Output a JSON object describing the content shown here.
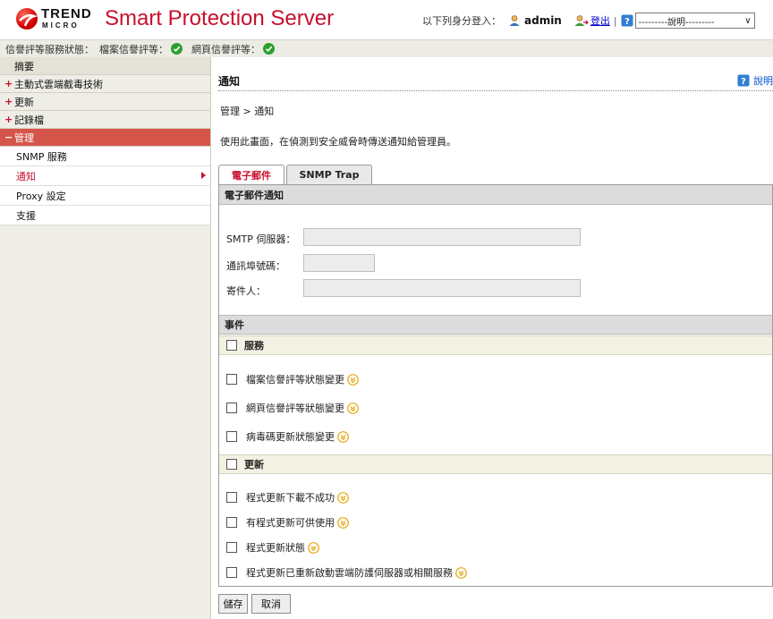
{
  "header": {
    "logo_trend": "TREND",
    "logo_micro": "MICRO",
    "app_title": "Smart Protection Server",
    "login_label": "以下列身分登入：",
    "username": "admin",
    "logout_label": "登出",
    "separator": "|",
    "help_select_value": "---------說明---------"
  },
  "status_bar": {
    "label": "信譽評等服務狀態：",
    "file_rep": "檔案信譽評等：",
    "web_rep": "網頁信譽評等："
  },
  "sidebar": {
    "summary": "摘要",
    "items": [
      {
        "label": "主動式雲端截毒技術",
        "marker": "+"
      },
      {
        "label": "更新",
        "marker": "+"
      },
      {
        "label": "記錄檔",
        "marker": "+"
      },
      {
        "label": "管理",
        "marker": "−"
      }
    ],
    "sub_items": [
      {
        "label": "SNMP 服務"
      },
      {
        "label": "通知"
      },
      {
        "label": "Proxy 設定"
      },
      {
        "label": "支援"
      }
    ]
  },
  "main": {
    "title": "通知",
    "help_label": "說明",
    "breadcrumb": "管理 > 通知",
    "description": "使用此畫面，在偵測到安全威脅時傳送通知給管理員。",
    "tabs": {
      "email": "電子郵件",
      "snmp": "SNMP Trap"
    },
    "email_section": "電子郵件通知",
    "smtp_label": "SMTP 伺服器：",
    "port_label": "通訊埠號碼：",
    "from_label": "寄件人：",
    "smtp_value": "",
    "port_value": "",
    "from_value": "",
    "events_section": "事件",
    "service_group": "服務",
    "service_events": [
      {
        "label": "檔案信譽評等狀態變更"
      },
      {
        "label": "網頁信譽評等狀態變更"
      },
      {
        "label": "病毒碼更新狀態變更"
      }
    ],
    "update_group": "更新",
    "update_events": [
      {
        "label": "程式更新下載不成功"
      },
      {
        "label": "有程式更新可供使用"
      },
      {
        "label": "程式更新狀態"
      },
      {
        "label": "程式更新已重新啟動雲端防護伺服器或相關服務"
      }
    ],
    "save_label": "儲存",
    "cancel_label": "取消"
  },
  "colors": {
    "brand_red": "#c8102e",
    "sidebar_bg": "#eeede6",
    "expanded_bg": "#d6554b",
    "status_ok": "#2ca02c",
    "expand_icon": "#e6a817"
  }
}
